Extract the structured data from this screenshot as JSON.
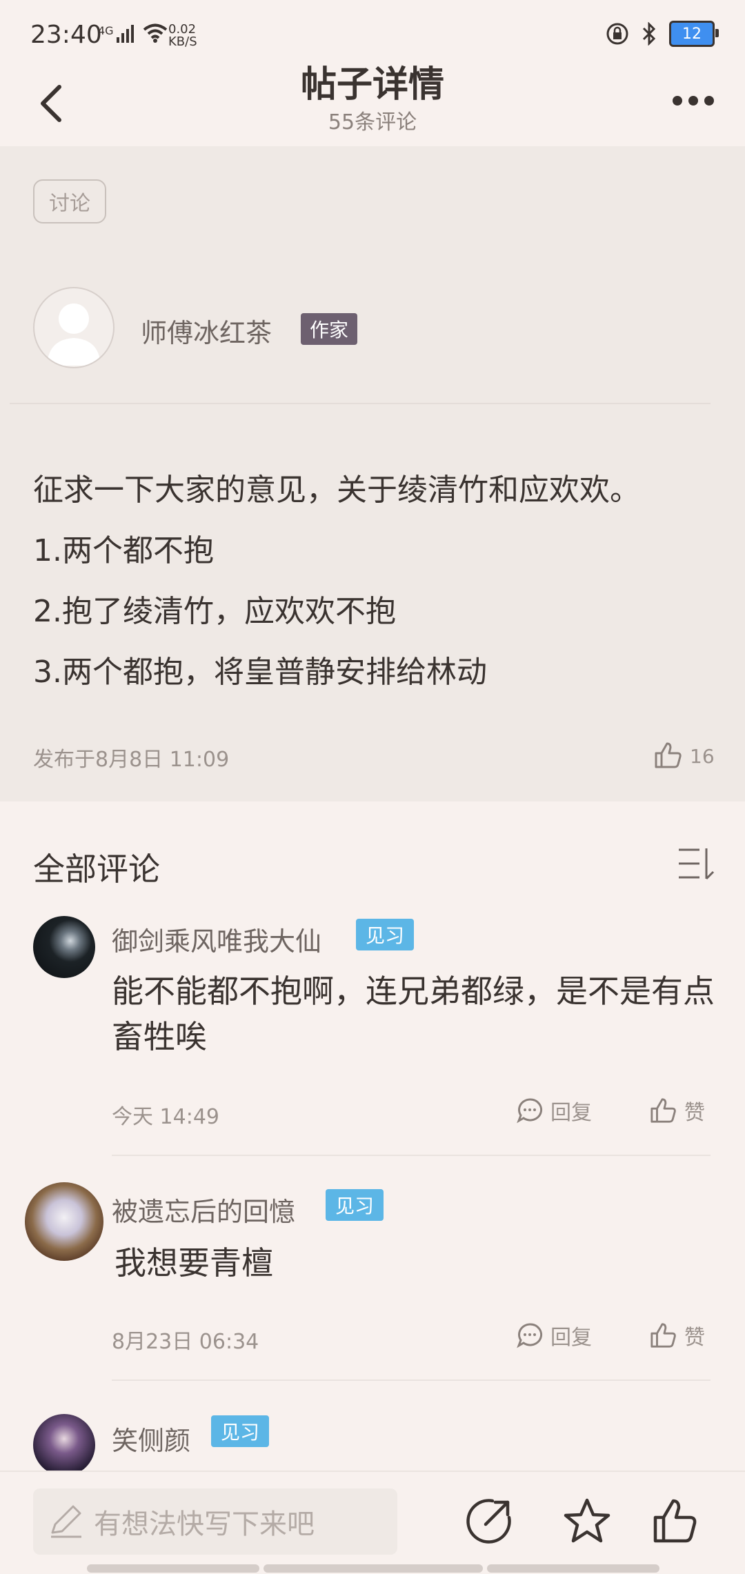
{
  "status_bar": {
    "time": "23:40",
    "network": "4G",
    "speed_value": "0.02",
    "speed_unit": "KB/S",
    "battery": "12"
  },
  "header": {
    "title": "帖子详情",
    "subtitle": "55条评论"
  },
  "post": {
    "tag": "讨论",
    "author": "师傅冰红茶",
    "author_badge": "作家",
    "lines": [
      "征求一下大家的意见，关于绫清竹和应欢欢。",
      "1.两个都不抱",
      "2.抱了绫清竹，应欢欢不抱",
      "3.两个都抱，将皇普静安排给林动"
    ],
    "publish_time": "发布于8月8日 11:09",
    "likes": "16"
  },
  "comments_section": {
    "title": "全部评论",
    "comments": [
      {
        "name": "御剑乘风唯我大仙",
        "badge": "见习",
        "text": "能不能都不抱啊，连兄弟都绿，是不是有点畜牲唉",
        "time": "今天 14:49",
        "reply": "回复",
        "like": "赞"
      },
      {
        "name": "被遗忘后的回憶",
        "badge": "见习",
        "text": "我想要青檀",
        "time": "8月23日 06:34",
        "reply": "回复",
        "like": "赞"
      },
      {
        "name": "笑侧颜",
        "badge": "见习"
      }
    ]
  },
  "bottom_bar": {
    "input_placeholder": "有想法快写下来吧"
  },
  "colors": {
    "background": "#f8f1ee",
    "post_background": "#efe9e5",
    "badge_blue": "#5cb6e6",
    "author_badge": "#6d6070"
  }
}
